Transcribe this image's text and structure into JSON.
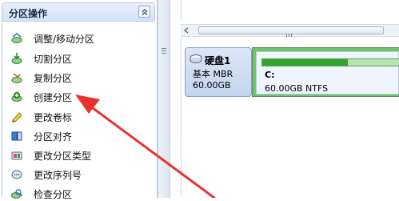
{
  "left_panel": {
    "title": "分区操作",
    "items": [
      {
        "label": "调整/移动分区",
        "icon": "resize-move-icon"
      },
      {
        "label": "切割分区",
        "icon": "split-icon"
      },
      {
        "label": "复制分区",
        "icon": "copy-icon"
      },
      {
        "label": "创建分区",
        "icon": "create-icon"
      },
      {
        "label": "更改卷标",
        "icon": "label-icon"
      },
      {
        "label": "分区对齐",
        "icon": "align-icon"
      },
      {
        "label": "更改分区类型",
        "icon": "partition-type-icon"
      },
      {
        "label": "更改序列号",
        "icon": "serial-number-icon"
      },
      {
        "label": "检查分区",
        "icon": "check-icon"
      }
    ]
  },
  "disk": {
    "name": "硬盘1",
    "type": "基本 MBR",
    "size": "60.00GB"
  },
  "partition": {
    "name": "C:",
    "info": "60.00GB NTFS",
    "used_fraction": 0.62
  },
  "colors": {
    "partition_bar": "#6fc46a",
    "usage_fill": "#33a52f",
    "annotation_arrow": "#e8322c",
    "disk_card": "#c4d5ee"
  }
}
